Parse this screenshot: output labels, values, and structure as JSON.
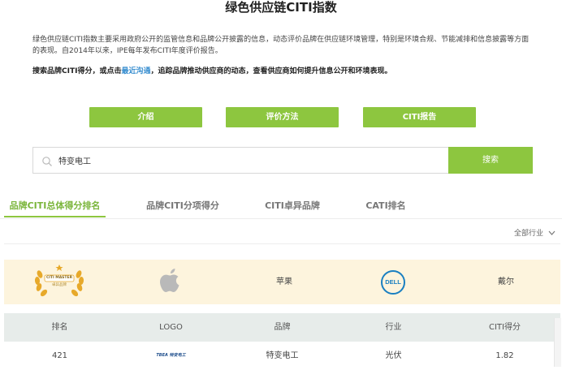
{
  "page": {
    "title": "绿色供应链CITI指数",
    "intro": "绿色供应链CITI指数主要采用政府公开的监管信息和品牌公开披露的信息，动态评价品牌在供应链环境管理，特别是环境合规、节能减排和信息披露等方面的表现。自2014年以来，IPE每年发布CITI年度评价报告。",
    "cta_prefix": "搜索品牌CITI得分，或点击",
    "cta_link": "最近沟通",
    "cta_suffix": "，追踪品牌推动供应商的动态，查看供应商如何提升信息公开和环境表现。"
  },
  "nav_buttons": [
    "介绍",
    "评价方法",
    "CITI报告"
  ],
  "search": {
    "value": "特变电工",
    "button": "搜索"
  },
  "tabs": [
    "品牌CITI总体得分排名",
    "品牌CITI分项得分",
    "CITI卓异品牌",
    "CATI排名"
  ],
  "filter": {
    "label": "全部行业"
  },
  "master_row": {
    "badge_line1": "CITI MASTER",
    "badge_line2": "卓异品牌",
    "brand1": "苹果",
    "brand2_logo": "DELL",
    "brand2": "戴尔"
  },
  "table": {
    "headers": [
      "排名",
      "LOGO",
      "品牌",
      "行业",
      "CITI得分"
    ],
    "rows": [
      {
        "rank": "421",
        "logo": "TBEA 特变电工",
        "brand": "特变电工",
        "industry": "光伏",
        "score": "1.82"
      }
    ]
  },
  "colors": {
    "accent": "#8dc63f",
    "link": "#3a8fd0",
    "master_bg": "#fdf4dd",
    "header_bg": "#e7ecea"
  }
}
